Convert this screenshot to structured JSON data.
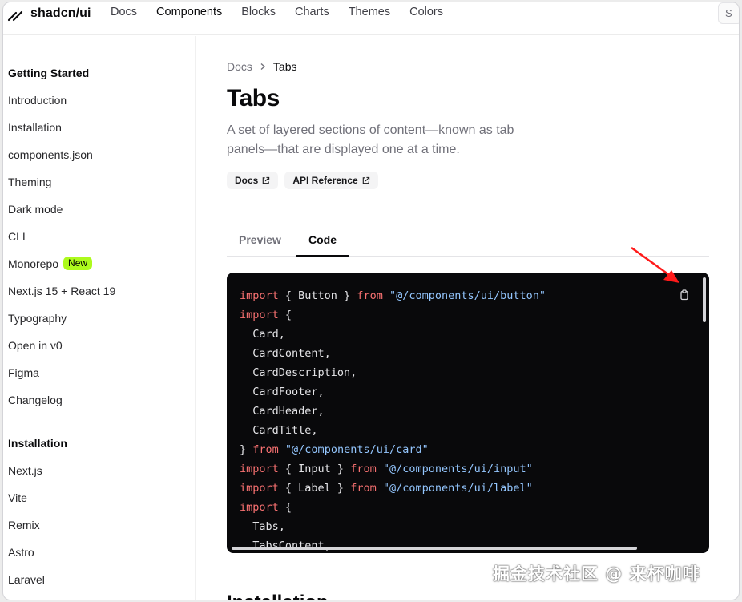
{
  "header": {
    "brand": "shadcn/ui",
    "nav": [
      "Docs",
      "Components",
      "Blocks",
      "Charts",
      "Themes",
      "Colors"
    ],
    "search_partial": "S"
  },
  "sidebar": {
    "group1_title": "Getting Started",
    "group1_items": [
      "Introduction",
      "Installation",
      "components.json",
      "Theming",
      "Dark mode",
      "CLI",
      "Monorepo",
      "Next.js 15 + React 19",
      "Typography",
      "Open in v0",
      "Figma",
      "Changelog"
    ],
    "monorepo_badge": "New",
    "group2_title": "Installation",
    "group2_items": [
      "Next.js",
      "Vite",
      "Remix",
      "Astro",
      "Laravel"
    ]
  },
  "main": {
    "breadcrumb": [
      "Docs",
      "Tabs"
    ],
    "title": "Tabs",
    "description": "A set of layered sections of content—known as tab panels—that are displayed one at a time.",
    "badges": [
      "Docs",
      "API Reference"
    ],
    "tabs": [
      "Preview",
      "Code"
    ],
    "next_heading": "Installation"
  },
  "code_lines": [
    [
      [
        "kw",
        "import"
      ],
      [
        "plain",
        " { Button } "
      ],
      [
        "kw",
        "from"
      ],
      [
        "plain",
        " "
      ],
      [
        "str",
        "\"@/components/ui/button\""
      ]
    ],
    [
      [
        "kw",
        "import"
      ],
      [
        "plain",
        " {"
      ]
    ],
    [
      [
        "plain",
        "  Card,"
      ]
    ],
    [
      [
        "plain",
        "  CardContent,"
      ]
    ],
    [
      [
        "plain",
        "  CardDescription,"
      ]
    ],
    [
      [
        "plain",
        "  CardFooter,"
      ]
    ],
    [
      [
        "plain",
        "  CardHeader,"
      ]
    ],
    [
      [
        "plain",
        "  CardTitle,"
      ]
    ],
    [
      [
        "plain",
        "} "
      ],
      [
        "kw",
        "from"
      ],
      [
        "plain",
        " "
      ],
      [
        "str",
        "\"@/components/ui/card\""
      ]
    ],
    [
      [
        "kw",
        "import"
      ],
      [
        "plain",
        " { Input } "
      ],
      [
        "kw",
        "from"
      ],
      [
        "plain",
        " "
      ],
      [
        "str",
        "\"@/components/ui/input\""
      ]
    ],
    [
      [
        "kw",
        "import"
      ],
      [
        "plain",
        " { Label } "
      ],
      [
        "kw",
        "from"
      ],
      [
        "plain",
        " "
      ],
      [
        "str",
        "\"@/components/ui/label\""
      ]
    ],
    [
      [
        "kw",
        "import"
      ],
      [
        "plain",
        " {"
      ]
    ],
    [
      [
        "plain",
        "  Tabs,"
      ]
    ],
    [
      [
        "plain",
        "  TabsContent,"
      ]
    ]
  ],
  "watermark": "掘金技术社区 @ 来杯咖啡",
  "colors": {
    "keyword": "#f87171",
    "string": "#93c5fd",
    "code_bg": "#09090b",
    "badge_new": "#adfa1d",
    "arrow": "#ff1a1a"
  }
}
